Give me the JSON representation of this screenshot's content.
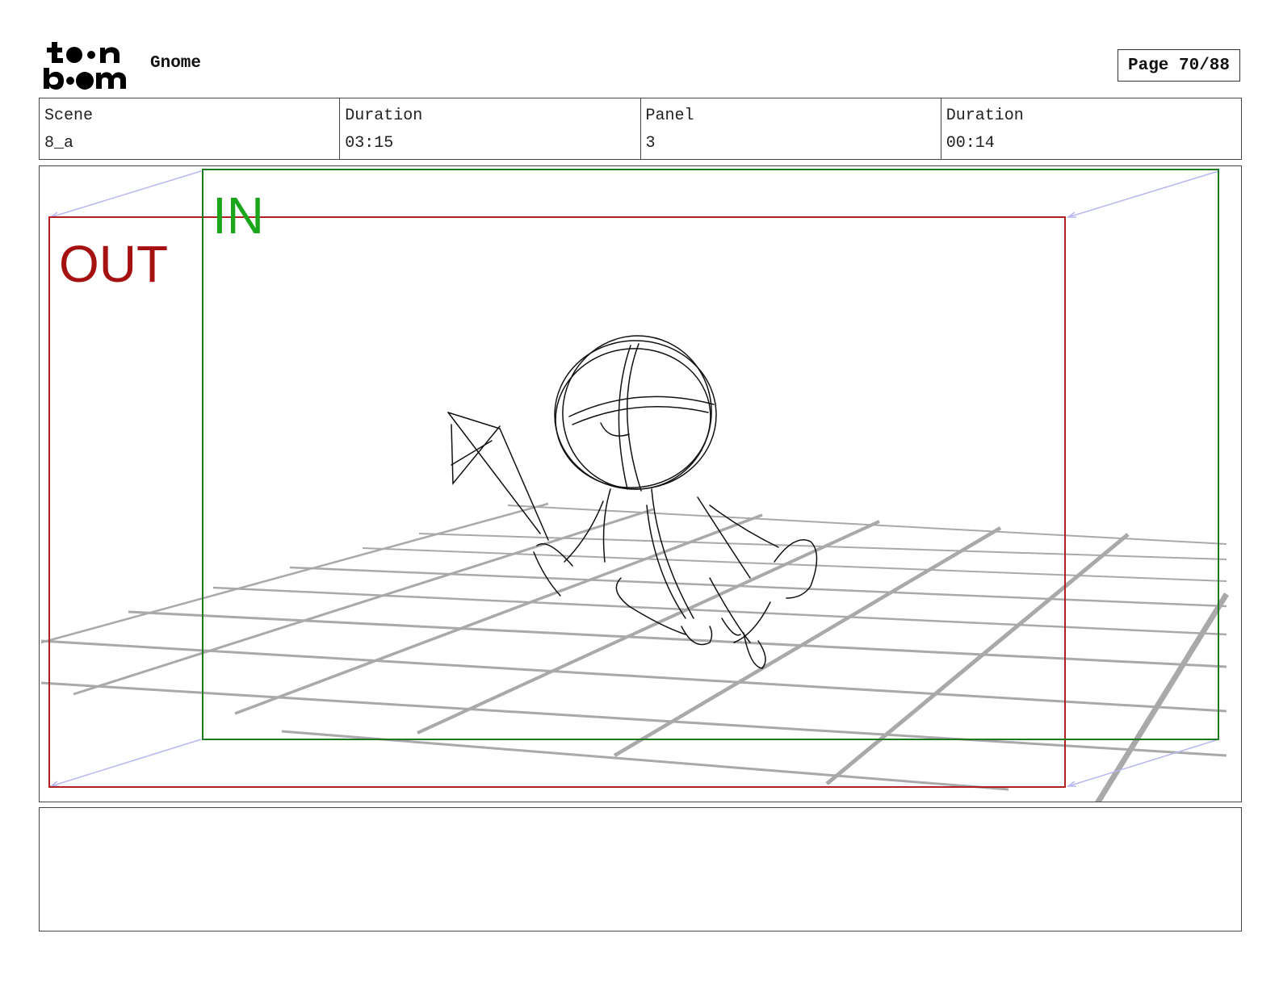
{
  "header": {
    "logo_text": "toon boom",
    "project_title": "Gnome",
    "page_label": "Page 70/88"
  },
  "info": [
    {
      "label": "Scene",
      "value": "8_a"
    },
    {
      "label": "Duration",
      "value": "03:15"
    },
    {
      "label": "Panel",
      "value": "3"
    },
    {
      "label": "Duration",
      "value": "00:14"
    }
  ],
  "panel": {
    "in_label": "IN",
    "out_label": "OUT",
    "colors": {
      "in_frame": "#1f7a1f",
      "in_text": "#1aa51a",
      "out_frame": "#b02020",
      "out_text": "#a51010",
      "guides": "#b8b8f0",
      "grid": "#a9a9a9",
      "sketch": "#111111"
    }
  },
  "notes": {
    "text": ""
  }
}
